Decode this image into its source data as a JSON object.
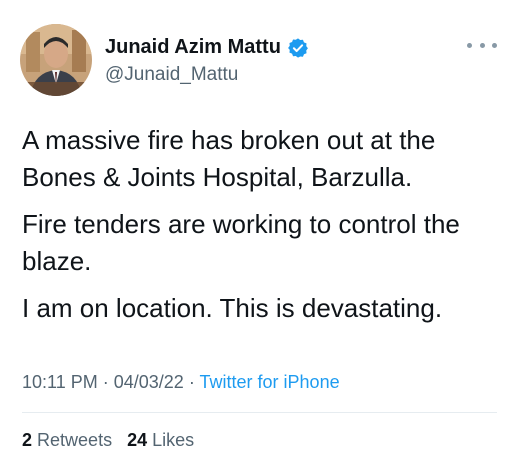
{
  "user": {
    "display_name": "Junaid Azim Mattu",
    "handle": "@Junaid_Mattu",
    "verified": true,
    "avatar_icon": "profile-photo"
  },
  "tweet": {
    "paragraphs": [
      "A massive fire has broken out at the Bones & Joints Hospital, Barzulla.",
      "Fire tenders are working to control the blaze.",
      "I am on location. This is devastating."
    ],
    "time": "10:11 PM",
    "date": "04/03/22",
    "separator": "·",
    "source": "Twitter for iPhone"
  },
  "stats": {
    "retweets_count": "2",
    "retweets_label": "Retweets",
    "likes_count": "24",
    "likes_label": "Likes"
  },
  "colors": {
    "link": "#1d9bf0",
    "secondary_text": "#536471",
    "verified_badge": "#1d9bf0"
  }
}
